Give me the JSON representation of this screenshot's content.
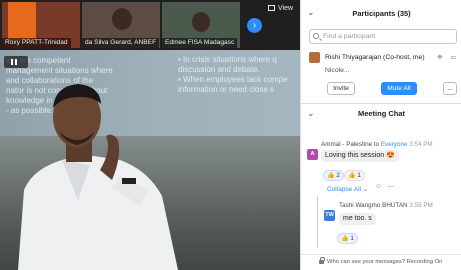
{
  "video": {
    "tiles": [
      {
        "name": "Roxy PPATT-Trinidad",
        "bg": "#7a3a2a"
      },
      {
        "name": "da Silva Gerard, ANBEF",
        "bg": "#5d4c44"
      },
      {
        "name": "Edmee FISA Madagasc",
        "bg": "#4c5a4e"
      }
    ],
    "view_label": "View",
    "slide_left": "ers are competent\nmanagement situations where\n and collaborations of the\nnator is not concerned about\nknowledge in the area, the\n- as possible.",
    "slide_right": "• In crisis situations where q\ndiscussion and debate.\n• When employees lack compe\ninformation or need close s"
  },
  "participants": {
    "title": "Participants (35)",
    "search_placeholder": "Find a participant",
    "host_name": "Rishi Thiyagarajan (Co-host, me)",
    "next_name": "Nicole...",
    "invite_label": "Invite",
    "mute_all_label": "Mute All",
    "more_label": "..."
  },
  "chat": {
    "title": "Meeting Chat",
    "message1": {
      "sender": "Ammal - Palestine",
      "to": "to",
      "target": "Everyone",
      "time": "3:54 PM",
      "avatar": "A",
      "text": "Loving this session 😍",
      "reactions": [
        "👍 2",
        "👍 1"
      ],
      "collapse_label": "Collapse All ⌄"
    },
    "message2": {
      "sender": "Tashi Wangmo BHUTAN",
      "time": "3:55 PM",
      "avatar": "TW",
      "text": "me too. s",
      "reaction": "👍 1"
    }
  },
  "footer": {
    "text": "Who can see your messages? Recording On"
  },
  "colors": {
    "accent": "#2d8cff",
    "avatar_a": "#b14aa8",
    "avatar_tw": "#3b7dd8"
  }
}
